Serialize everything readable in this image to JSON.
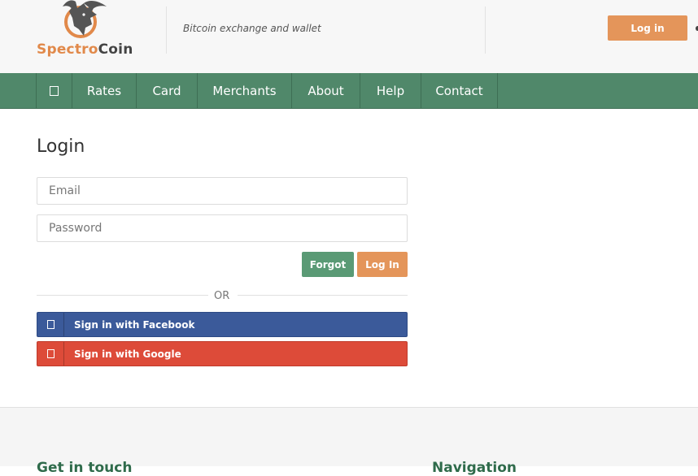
{
  "header": {
    "logo_part1": "Spectro",
    "logo_part2": "Coin",
    "tagline": "Bitcoin exchange and wallet",
    "login_button": "Log in"
  },
  "nav": {
    "home_icon": "home-icon",
    "items": [
      {
        "label": "Rates"
      },
      {
        "label": "Card"
      },
      {
        "label": "Merchants"
      },
      {
        "label": "About"
      },
      {
        "label": "Help"
      },
      {
        "label": "Contact"
      }
    ]
  },
  "login": {
    "title": "Login",
    "email_value": "",
    "email_placeholder": "Email",
    "password_value": "",
    "password_placeholder": "Password",
    "forgot_button": "Forgot",
    "login_button": "Log In",
    "or_text": "OR",
    "facebook_button": "Sign in with Facebook",
    "google_button": "Sign in with Google"
  },
  "footer": {
    "get_in_touch": "Get in touch",
    "navigation": "Navigation"
  },
  "colors": {
    "brand_orange": "#e4955a",
    "nav_green": "#50886a",
    "forgot_green": "#5a9a75",
    "facebook_blue": "#3b5a9a",
    "google_red": "#dd4b39",
    "footer_heading": "#2f6b4b"
  }
}
